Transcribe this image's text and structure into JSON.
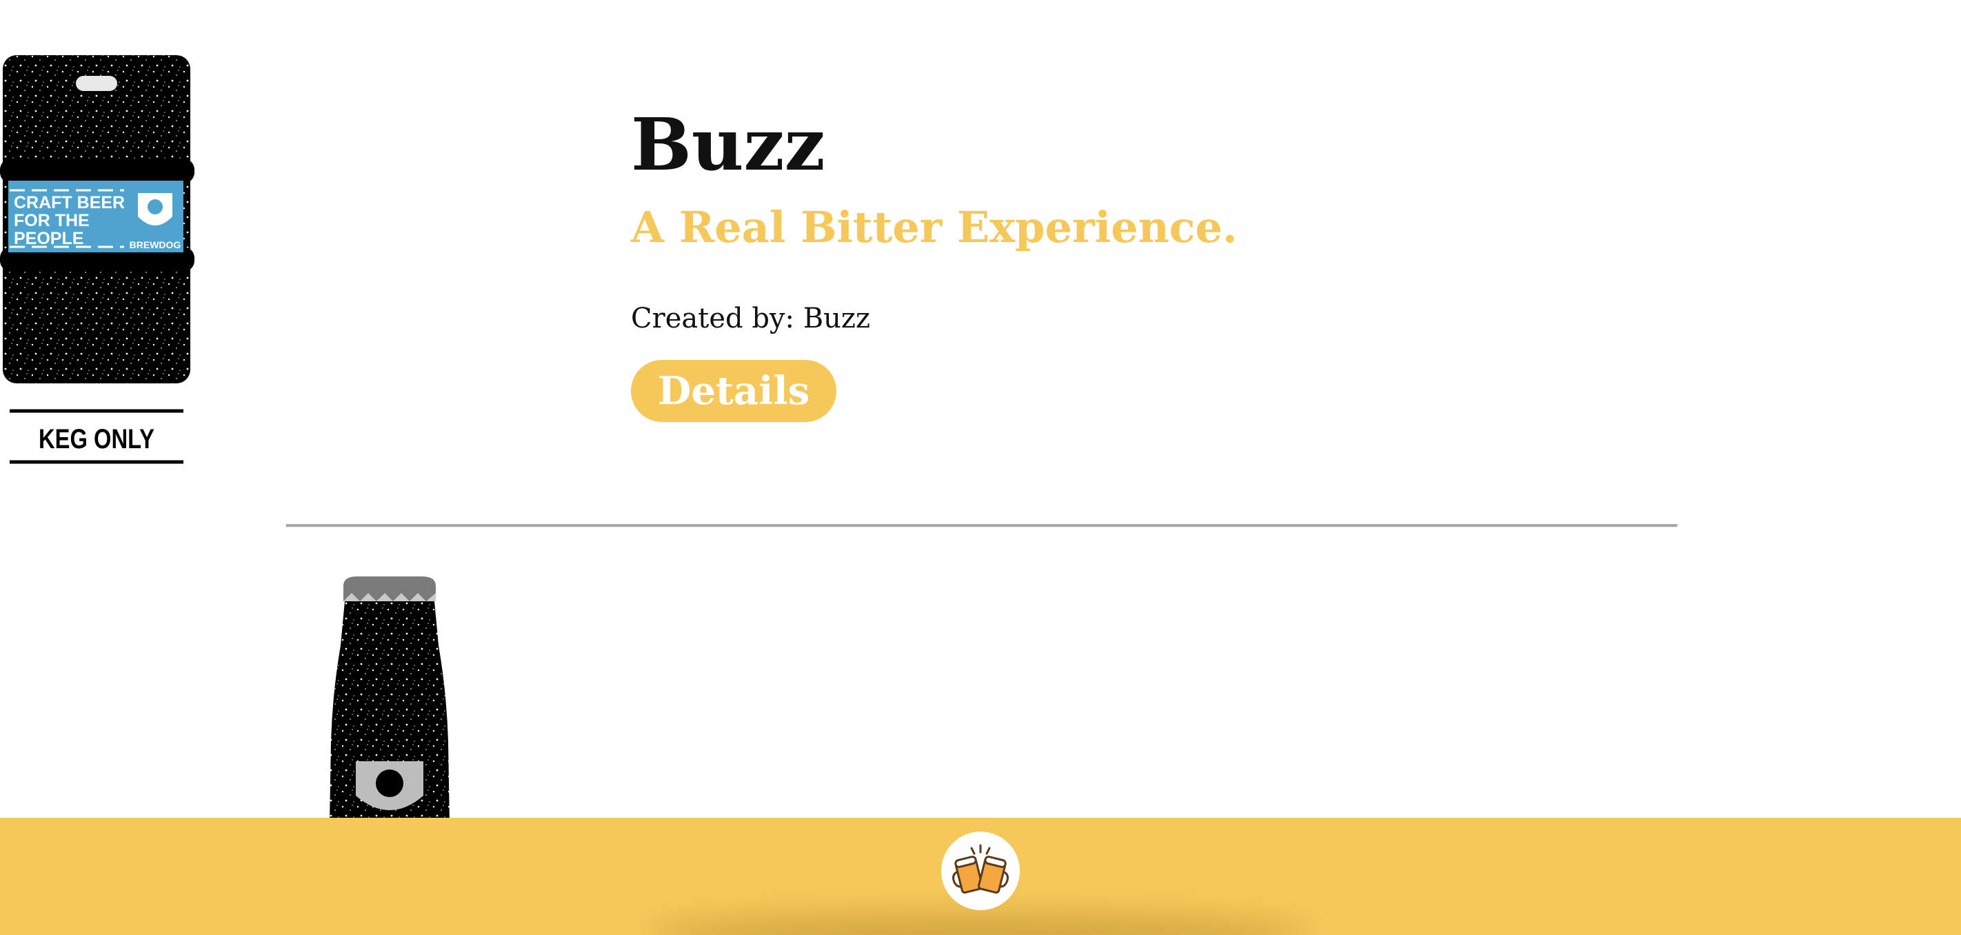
{
  "beers": [
    {
      "name": "Buzz",
      "tagline": "A Real Bitter Experience.",
      "creator_text": "Created by: Buzz",
      "details_label": "Details",
      "image": {
        "kind": "keg",
        "label_lines": [
          "CRAFT BEER",
          "FOR THE",
          "PEOPLE"
        ],
        "brand": "BREWDOG",
        "badge": "KEG ONLY"
      }
    },
    {
      "image": {
        "kind": "bottle"
      }
    }
  ],
  "footer": {
    "home_icon": "cheers-beer-mugs-icon"
  },
  "colors": {
    "accent": "#f6c85a",
    "label_blue": "#4fa3cf",
    "divider": "#a8a8a8",
    "text": "#111111"
  }
}
